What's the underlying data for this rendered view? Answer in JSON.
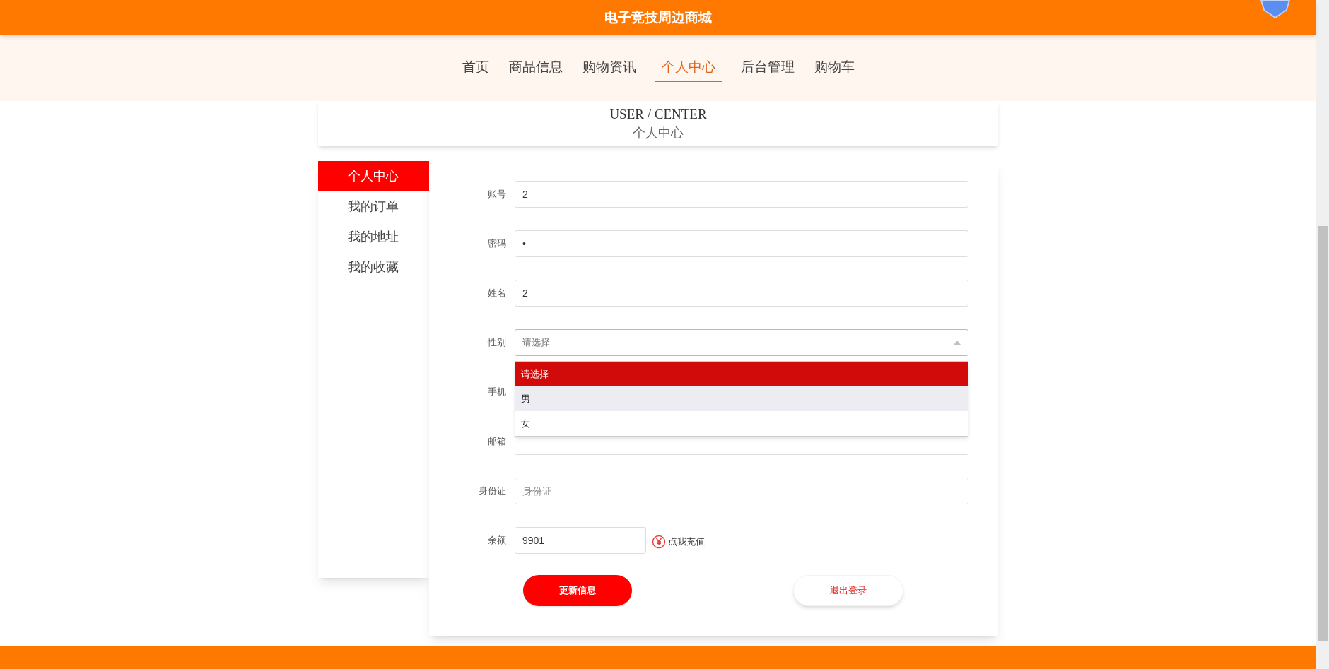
{
  "header": {
    "title": "电子竞技周边商城"
  },
  "nav": [
    {
      "label": "首页",
      "selected": false
    },
    {
      "label": "商品信息",
      "selected": false
    },
    {
      "label": "购物资讯",
      "selected": false
    },
    {
      "label": "个人中心",
      "selected": true
    },
    {
      "label": "后台管理",
      "selected": false
    },
    {
      "label": "购物车",
      "selected": false
    }
  ],
  "page_title": {
    "english": "USER / CENTER",
    "chinese": "个人中心"
  },
  "sidebar": [
    {
      "label": "个人中心",
      "selected": true
    },
    {
      "label": "我的订单",
      "selected": false
    },
    {
      "label": "我的地址",
      "selected": false
    },
    {
      "label": "我的收藏",
      "selected": false
    }
  ],
  "form": [
    {
      "kind": "input",
      "label": "账号",
      "value": "2"
    },
    {
      "kind": "input",
      "label": "密码",
      "value": "•"
    },
    {
      "kind": "input",
      "label": "姓名",
      "value": "2"
    },
    {
      "kind": "select",
      "label": "性别",
      "placeholder": "请选择",
      "expanded": true,
      "options": [
        {
          "label": "请选择",
          "selected": true,
          "hovered": false
        },
        {
          "label": "男",
          "selected": false,
          "hovered": true
        },
        {
          "label": "女",
          "selected": false,
          "hovered": false
        }
      ]
    },
    {
      "kind": "input",
      "label": "手机"
    },
    {
      "kind": "input",
      "label": "邮箱"
    },
    {
      "kind": "input",
      "label": "身份证",
      "placeholder": "身份证"
    },
    {
      "kind": "balance",
      "label": "余额",
      "value": "9901",
      "link": "点我充值"
    }
  ],
  "buttons": [
    {
      "kind": "primary",
      "label": "更新信息"
    },
    {
      "kind": "secondary",
      "label": "退出登录"
    }
  ]
}
